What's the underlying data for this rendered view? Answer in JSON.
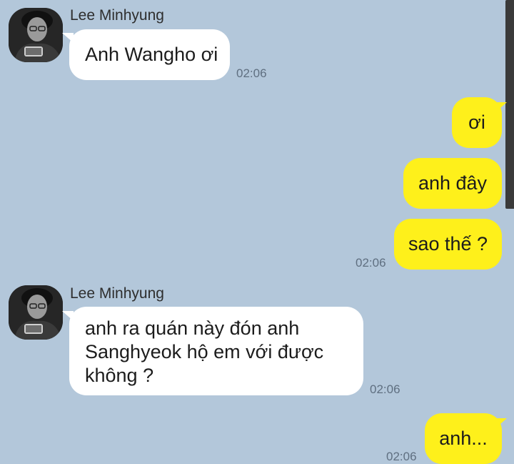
{
  "chat": {
    "messages": [
      {
        "direction": "incoming",
        "sender": "Lee Minhyung",
        "text": "Anh Wangho ơi",
        "time": "02:06"
      },
      {
        "direction": "outgoing",
        "bubbles": [
          "ơi",
          "anh đây",
          "sao thế ?"
        ],
        "time": "02:06"
      },
      {
        "direction": "incoming",
        "sender": "Lee Minhyung",
        "lines": [
          "anh ra quán này đón anh",
          "Sanghyeok hộ em với được",
          "không ?"
        ],
        "time": "02:06"
      },
      {
        "direction": "outgoing",
        "bubbles": [
          "anh..."
        ],
        "time": "02:06"
      }
    ]
  },
  "colors": {
    "background": "#b3c7da",
    "outgoing_bubble": "#fef01b",
    "incoming_bubble": "#ffffff",
    "timestamp": "#5f6f80"
  },
  "icons": {
    "avatar": "profile-photo-avatar"
  }
}
